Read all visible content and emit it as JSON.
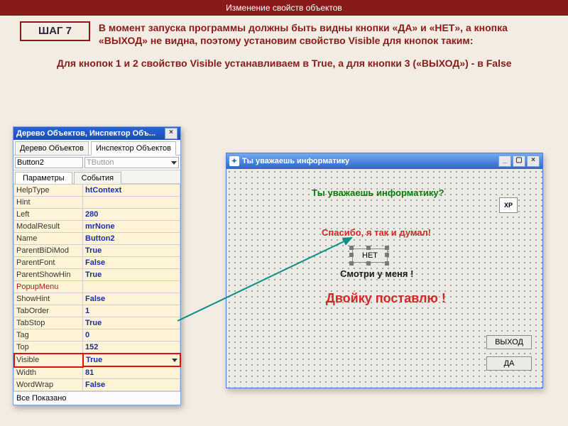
{
  "page": {
    "title": "Изменение свойств объектов",
    "step_label": "ШАГ 7",
    "paragraph1": "В момент запуска программы должны быть видны кнопки «ДА» и «НЕТ», а кнопка «ВЫХОД» не видна, поэтому установим свойство Visible для кнопок таким:",
    "paragraph2": "Для кнопок 1 и 2 свойство Visible устанавливаем в True, а для кнопки 3 («ВЫХОД») - в False"
  },
  "inspector": {
    "window_title": "Дерево Объектов, Инспектор Объ...",
    "tab_tree": "Дерево Объектов",
    "tab_inspector": "Инспектор Объектов",
    "combo_name": "Button2",
    "combo_class": "TButton",
    "tab_params": "Параметры",
    "tab_events": "События",
    "footer": "Все Показано",
    "props": [
      {
        "name": "HelpType",
        "value": "htContext"
      },
      {
        "name": "Hint",
        "value": ""
      },
      {
        "name": "Left",
        "value": "280"
      },
      {
        "name": "ModalResult",
        "value": "mrNone"
      },
      {
        "name": "Name",
        "value": "Button2"
      },
      {
        "name": "ParentBiDiMod",
        "value": "True"
      },
      {
        "name": "ParentFont",
        "value": "False"
      },
      {
        "name": "ParentShowHin",
        "value": "True"
      },
      {
        "name": "PopupMenu",
        "value": ""
      },
      {
        "name": "ShowHint",
        "value": "False"
      },
      {
        "name": "TabOrder",
        "value": "1"
      },
      {
        "name": "TabStop",
        "value": "True"
      },
      {
        "name": "Tag",
        "value": "0"
      },
      {
        "name": "Top",
        "value": "152"
      },
      {
        "name": "Visible",
        "value": "True"
      },
      {
        "name": "Width",
        "value": "81"
      },
      {
        "name": "WordWrap",
        "value": "False"
      }
    ]
  },
  "app": {
    "title": "Ты уважаешь информатику",
    "question": "Ты уважаешь информатику?",
    "reply1": "Спасибо, я так и думал!",
    "reply2": "Смотри у меня !",
    "reply3": "Двойку поставлю !",
    "btn_no": "НЕТ",
    "btn_exit": "ВЫХОД",
    "btn_yes": "ДА",
    "xp_badge": "XP"
  }
}
